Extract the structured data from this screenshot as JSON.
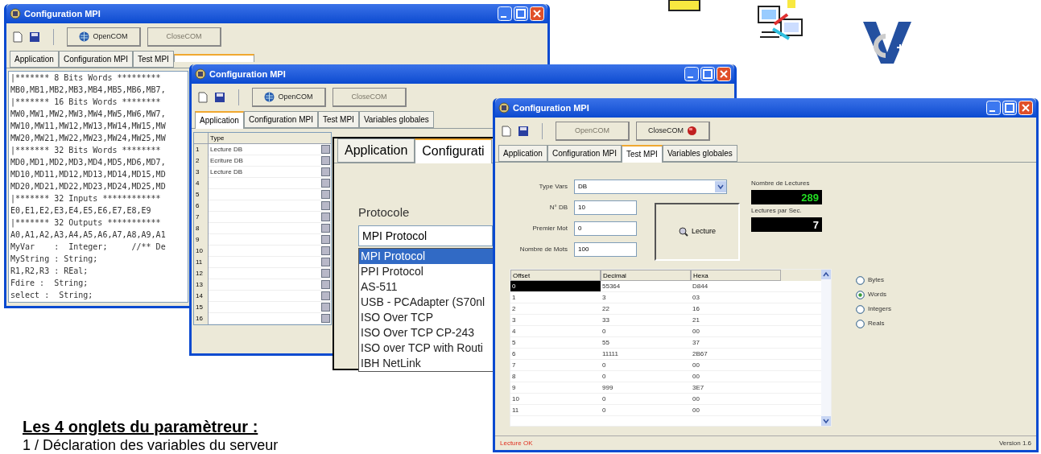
{
  "windows": [
    {
      "kind": "code",
      "title": "Configuration MPI",
      "buttons": [
        {
          "label": "OpenCOM",
          "disabled": false
        },
        {
          "label": "CloseCOM",
          "disabled": true
        }
      ],
      "tabs": [
        {
          "label": "Application",
          "selected": false
        },
        {
          "label": "Configuration MPI",
          "selected": false
        },
        {
          "label": "Test MPI",
          "selected": false
        },
        {
          "selected": true
        }
      ],
      "lines": [
        "|******* 8 Bits Words *********",
        "MB0,MB1,MB2,MB3,MB4,MB5,MB6,MB7,",
        "|******* 16 Bits Words ********",
        "MW0,MW1,MW2,MW3,MW4,MW5,MW6,MW7,",
        "MW10,MW11,MW12,MW13,MW14,MW15,MW",
        "MW20,MW21,MW22,MW23,MW24,MW25,MW",
        "|******* 32 Bits Words ********",
        "MD0,MD1,MD2,MD3,MD4,MD5,MD6,MD7,",
        "MD10,MD11,MD12,MD13,MD14,MD15,MD",
        "MD20,MD21,MD22,MD23,MD24,MD25,MD",
        "|******* 32 Inputs ************",
        "E0,E1,E2,E3,E4,E5,E6,E7,E8,E9",
        "|******* 32 Outputs ***********",
        "A0,A1,A2,A3,A4,A5,A6,A7,A8,A9,A1",
        "MyVar    :  Integer;     //** De",
        "MyString : String;",
        "R1,R2,R3 : REal;",
        "Fdire :  String;",
        "select :  String;"
      ]
    },
    {
      "kind": "grid",
      "title": "Configuration MPI",
      "buttons": [
        {
          "label": "OpenCOM",
          "disabled": false
        },
        {
          "label": "CloseCOM",
          "disabled": true
        }
      ],
      "tabs": [
        {
          "label": "Application",
          "selected": true
        },
        {
          "label": "Configuration MPI",
          "selected": false
        },
        {
          "label": "Test MPI",
          "selected": false
        },
        {
          "label": "Variables globales",
          "selected": false
        }
      ],
      "grid": {
        "header": "Type",
        "rows": [
          {
            "number": "1",
            "type": "Lecture DB"
          },
          {
            "number": "2",
            "type": "Ecriture DB"
          },
          {
            "number": "3",
            "type": "Lecture DB"
          },
          {
            "number": "4"
          },
          {
            "number": "5"
          },
          {
            "number": "6"
          },
          {
            "number": "7"
          },
          {
            "number": "8"
          },
          {
            "number": "9"
          },
          {
            "number": "10"
          },
          {
            "number": "11"
          },
          {
            "number": "12"
          },
          {
            "number": "13"
          },
          {
            "number": "14"
          },
          {
            "number": "15"
          },
          {
            "number": "16"
          }
        ]
      }
    },
    {
      "kind": "test",
      "title": "Configuration MPI",
      "buttons": [
        {
          "label": "OpenCOM",
          "disabled": true
        },
        {
          "label": "CloseCOM",
          "disabled": false
        }
      ],
      "tabs": [
        {
          "label": "Application",
          "selected": false
        },
        {
          "label": "Configuration MPI",
          "selected": false
        },
        {
          "label": "Test MPI",
          "selected": true
        },
        {
          "label": "Variables globales",
          "selected": false
        }
      ],
      "fields": [
        {
          "label": "Type Vars",
          "value": "DB",
          "kind": "combo"
        },
        {
          "label": "N° DB",
          "value": "10",
          "kind": "text"
        },
        {
          "label": "Premier Mot",
          "value": "0",
          "kind": "text"
        },
        {
          "label": "Nombre de Mots",
          "value": "100",
          "kind": "text"
        }
      ],
      "read_button": "Lecture",
      "counters": [
        {
          "label": "Nombre de Lectures",
          "value": "289",
          "color": "#22dd22"
        },
        {
          "label": "Lectures par Sec.",
          "value": "7",
          "color": "#ffffff"
        }
      ],
      "table": {
        "columns": [
          "Offset",
          "Decimal",
          "Hexa"
        ],
        "rows": [
          {
            "cells": [
              "0",
              "55364",
              "D844"
            ],
            "selected": true
          },
          {
            "cells": [
              "1",
              "3",
              "03"
            ],
            "selected": false
          },
          {
            "cells": [
              "2",
              "22",
              "16"
            ],
            "selected": false
          },
          {
            "cells": [
              "3",
              "33",
              "21"
            ],
            "selected": false
          },
          {
            "cells": [
              "4",
              "0",
              "00"
            ],
            "selected": false
          },
          {
            "cells": [
              "5",
              "55",
              "37"
            ],
            "selected": false
          },
          {
            "cells": [
              "6",
              "11111",
              "2B67"
            ],
            "selected": false
          },
          {
            "cells": [
              "7",
              "0",
              "00"
            ],
            "selected": false
          },
          {
            "cells": [
              "8",
              "0",
              "00"
            ],
            "selected": false
          },
          {
            "cells": [
              "9",
              "999",
              "3E7"
            ],
            "selected": false
          },
          {
            "cells": [
              "10",
              "0",
              "00"
            ],
            "selected": false
          },
          {
            "cells": [
              "11",
              "0",
              "00"
            ],
            "selected": false
          }
        ]
      },
      "radios": [
        {
          "label": "Bytes",
          "selected": false
        },
        {
          "label": "Words",
          "selected": true
        },
        {
          "label": "Integers",
          "selected": false
        },
        {
          "label": "Reals",
          "selected": false
        }
      ],
      "status": "Lecture OK",
      "version": "Version 1.6"
    }
  ],
  "inset": {
    "tabs": [
      {
        "label": "Application",
        "selected": false
      },
      {
        "label": "Configurati",
        "selected": true
      }
    ],
    "label": "Protocole",
    "value": "MPI Protocol",
    "options": [
      {
        "label": "MPI Protocol",
        "selected": true
      },
      {
        "label": "PPI Protocol",
        "selected": false
      },
      {
        "label": "AS-511",
        "selected": false
      },
      {
        "label": "USB - PCAdapter (S70nl",
        "selected": false
      },
      {
        "label": "ISO Over TCP",
        "selected": false
      },
      {
        "label": "ISO Over TCP CP-243",
        "selected": false
      },
      {
        "label": "ISO over TCP with Routi",
        "selected": false
      },
      {
        "label": "IBH NetLink",
        "selected": false
      }
    ]
  },
  "heading": "Les 4 onglets du paramètreur :",
  "line": "1 / Déclaration des variables du serveur"
}
